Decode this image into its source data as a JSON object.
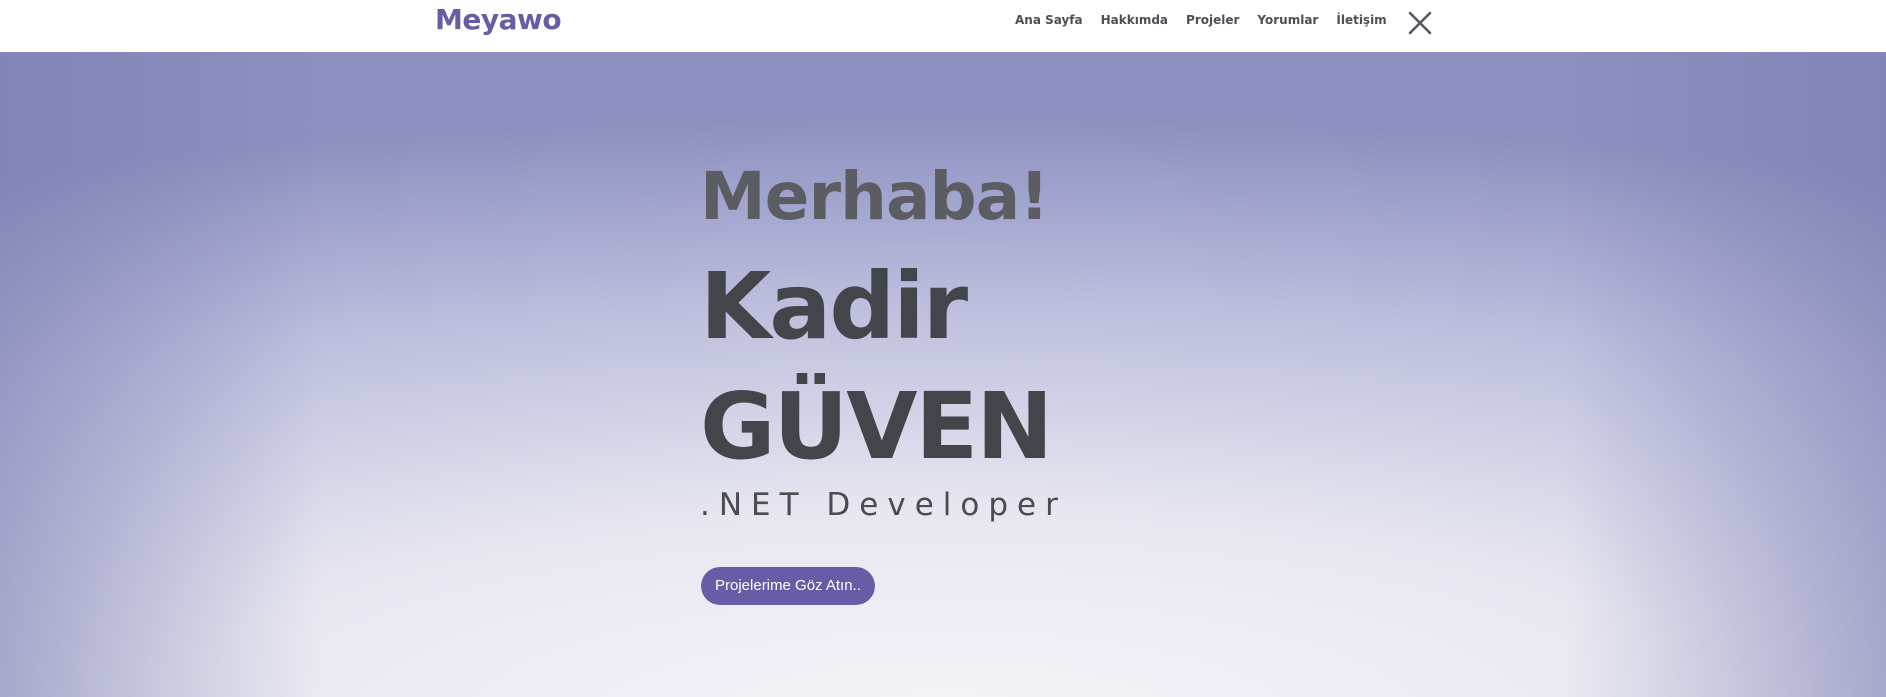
{
  "header": {
    "logo": "Meyawo",
    "nav": [
      {
        "label": "Ana Sayfa"
      },
      {
        "label": "Hakkımda"
      },
      {
        "label": "Projeler"
      },
      {
        "label": "Yorumlar"
      },
      {
        "label": "İletişim"
      }
    ],
    "close_icon": "close-icon"
  },
  "hero": {
    "greeting": "Merhaba!",
    "name_first": "Kadir",
    "name_last": "GÜVEN",
    "role": ".NET Developer",
    "cta_label": "Projelerime Göz Atın.."
  },
  "colors": {
    "brand": "#6a5ba6",
    "heading": "#424549",
    "nav_text": "#4c4f55"
  }
}
